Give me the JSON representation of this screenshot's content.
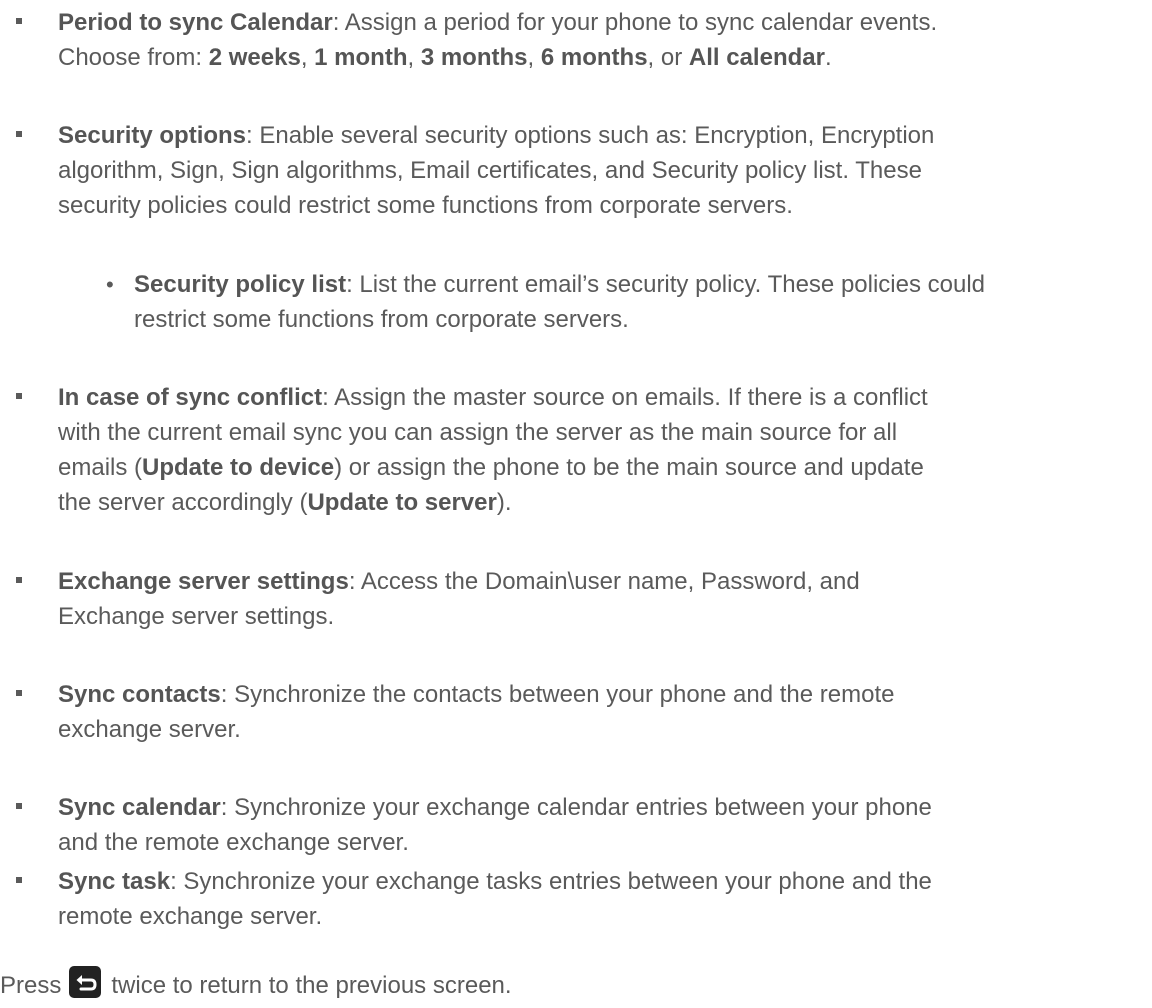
{
  "items": [
    {
      "lines": [
        [
          {
            "b": "Period to sync Calendar"
          },
          {
            "t": ": Assign a period for your phone to sync calendar events."
          }
        ],
        [
          {
            "t": "Choose from: "
          },
          {
            "b": "2 weeks"
          },
          {
            "t": ", "
          },
          {
            "b": "1 month"
          },
          {
            "t": ", "
          },
          {
            "b": "3 months"
          },
          {
            "t": ", "
          },
          {
            "b": "6 months"
          },
          {
            "t": ", or "
          },
          {
            "b": "All calendar"
          },
          {
            "t": "."
          }
        ]
      ]
    },
    {
      "lines": [
        [
          {
            "b": "Security options"
          },
          {
            "t": ": Enable several security options such as: Encryption, Encryption"
          }
        ],
        [
          {
            "t": "algorithm, Sign, Sign algorithms, Email certificates, and Security policy list. These"
          }
        ],
        [
          {
            "t": "security policies could restrict some functions from corporate servers."
          }
        ]
      ]
    },
    {
      "lines": [
        [
          {
            "b": "Security policy list"
          },
          {
            "t": ": List the current email’s security policy. These policies could"
          }
        ],
        [
          {
            "t": "restrict some functions from corporate servers."
          }
        ]
      ]
    },
    {
      "lines": [
        [
          {
            "b": "In case of sync conflict"
          },
          {
            "t": ": Assign the master source on emails. If there is a conflict"
          }
        ],
        [
          {
            "t": "with the current email sync you can assign the server as the main source for all"
          }
        ],
        [
          {
            "t": "emails ("
          },
          {
            "b": "Update to device"
          },
          {
            "t": ") or assign the phone to be the main source and update"
          }
        ],
        [
          {
            "t": "the server accordingly ("
          },
          {
            "b": "Update to server"
          },
          {
            "t": ")."
          }
        ]
      ]
    },
    {
      "lines": [
        [
          {
            "b": "Exchange server settings"
          },
          {
            "t": ": Access the Domain\\user name, Password, and"
          }
        ],
        [
          {
            "t": "Exchange server settings."
          }
        ]
      ]
    },
    {
      "lines": [
        [
          {
            "b": "Sync contacts"
          },
          {
            "t": ": Synchronize the contacts between your phone and the remote"
          }
        ],
        [
          {
            "t": "exchange server."
          }
        ]
      ]
    },
    {
      "lines": [
        [
          {
            "b": "Sync calendar"
          },
          {
            "t": ": Synchronize your exchange calendar entries between your phone"
          }
        ],
        [
          {
            "t": "and the remote exchange server."
          }
        ]
      ]
    },
    {
      "lines": [
        [
          {
            "b": "Sync task"
          },
          {
            "t": ": Synchronize your exchange tasks entries between your phone and the"
          }
        ],
        [
          {
            "t": "remote exchange server."
          }
        ]
      ]
    }
  ],
  "footer": {
    "before_icon": "Press",
    "icon": "back-icon",
    "after_icon": "twice to return to the previous screen."
  }
}
